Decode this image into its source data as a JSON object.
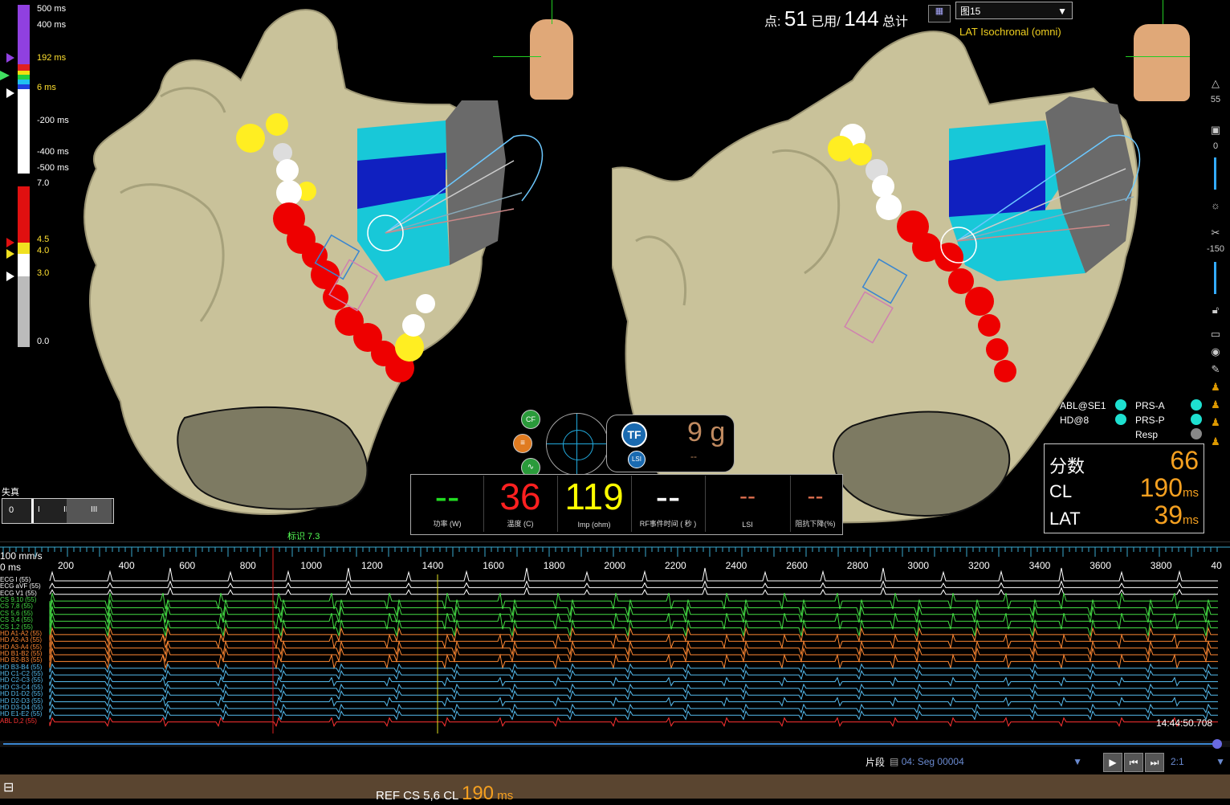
{
  "header": {
    "points_label": "点:",
    "points_value": "51",
    "used_label": "已用/",
    "total_value": "144",
    "total_label": "总计",
    "map_select": "图15",
    "map_type": "LAT Isochronal (omni)"
  },
  "lat_scale": {
    "labels": [
      "500 ms",
      "400 ms",
      "192 ms",
      "6 ms",
      "-200 ms",
      "-400 ms",
      "-500 ms"
    ]
  },
  "bipolar_scale": {
    "labels": [
      "7.0",
      "4.5",
      "4.0",
      "3.0",
      "0.0"
    ]
  },
  "distortion": {
    "label": "失真",
    "value": "0",
    "ticks": [
      "I",
      "II",
      "III"
    ]
  },
  "left_view": {
    "marker_label": "标识 7.3"
  },
  "catheter_badges": {
    "cf": "CF",
    "tf": "TF",
    "lsi": "LSI",
    "force": "9 g",
    "force_sub": "--"
  },
  "ablation_metrics": [
    {
      "value": "--",
      "label": "功率 (W)",
      "color": "#22dd22"
    },
    {
      "value": "36",
      "label": "温度 (C)",
      "color": "#ff2020"
    },
    {
      "value": "119",
      "label": "Imp (ohm)",
      "color": "#ffff00"
    },
    {
      "value": "--",
      "label": "RF事件时间 ( 秒 )",
      "color": "#ffffff"
    },
    {
      "value": "--",
      "label": "LSI",
      "color": "#e07050"
    },
    {
      "value": "--",
      "label": "阻抗下降(%)",
      "color": "#e07050"
    }
  ],
  "status_indicators": {
    "left": [
      "ABL@SE1",
      "HD@8"
    ],
    "right": [
      "PRS-A",
      "PRS-P",
      "Resp"
    ]
  },
  "stats": {
    "score_label": "分数",
    "score_value": "66",
    "cl_label": "CL",
    "cl_value": "190",
    "cl_unit": "ms",
    "lat_label": "LAT",
    "lat_value": "39",
    "lat_unit": "ms"
  },
  "side_toolbar": {
    "value1": "55",
    "value2": "0",
    "value3": "-150"
  },
  "timeline": {
    "speed": "100 mm/s",
    "start": "0 ms",
    "ticks": [
      "200",
      "400",
      "600",
      "800",
      "1000",
      "1200",
      "1400",
      "1600",
      "1800",
      "2000",
      "2200",
      "2400",
      "2600",
      "2800",
      "3000",
      "3200",
      "3400",
      "3600",
      "3800",
      "40"
    ],
    "timestamp": "14:44:50.708"
  },
  "channels": [
    {
      "name": "ECG I (55)",
      "color": "#ffffff"
    },
    {
      "name": "ECG aVF (55)",
      "color": "#ffffff"
    },
    {
      "name": "ECG V1 (55)",
      "color": "#ffffff"
    },
    {
      "name": "CS 9,10 (55)",
      "color": "#44dd44"
    },
    {
      "name": "CS 7,8 (55)",
      "color": "#44dd44"
    },
    {
      "name": "CS 5,6 (55)",
      "color": "#44dd44"
    },
    {
      "name": "CS 3,4 (55)",
      "color": "#44dd44"
    },
    {
      "name": "CS 1,2 (55)",
      "color": "#44dd44"
    },
    {
      "name": "HD A1-A2 (55)",
      "color": "#ff8833"
    },
    {
      "name": "HD A2-A3 (55)",
      "color": "#ff8833"
    },
    {
      "name": "HD A3-A4 (55)",
      "color": "#ff8833"
    },
    {
      "name": "HD B1-B2 (55)",
      "color": "#ff8833"
    },
    {
      "name": "HD B2-B3 (55)",
      "color": "#ff8833"
    },
    {
      "name": "HD B3-B4 (55)",
      "color": "#55bbee"
    },
    {
      "name": "HD C1-C2 (55)",
      "color": "#55bbee"
    },
    {
      "name": "HD C2-C3 (55)",
      "color": "#55bbee"
    },
    {
      "name": "HD C3-C4 (55)",
      "color": "#55bbee"
    },
    {
      "name": "HD D1-D2 (55)",
      "color": "#55bbee"
    },
    {
      "name": "HD D2-D3 (55)",
      "color": "#55bbee"
    },
    {
      "name": "HD D3-D4 (55)",
      "color": "#55bbee"
    },
    {
      "name": "HD E1-E2 (55)",
      "color": "#55bbee"
    },
    {
      "name": "ABL D,2 (55)",
      "color": "#ff3333"
    }
  ],
  "segment": {
    "label": "片段",
    "value": "04: Seg 00004",
    "ratio": "2:1"
  },
  "footer": {
    "ref_label": "REF CS 5,6 CL",
    "ref_value": "190",
    "ref_unit": "ms"
  }
}
